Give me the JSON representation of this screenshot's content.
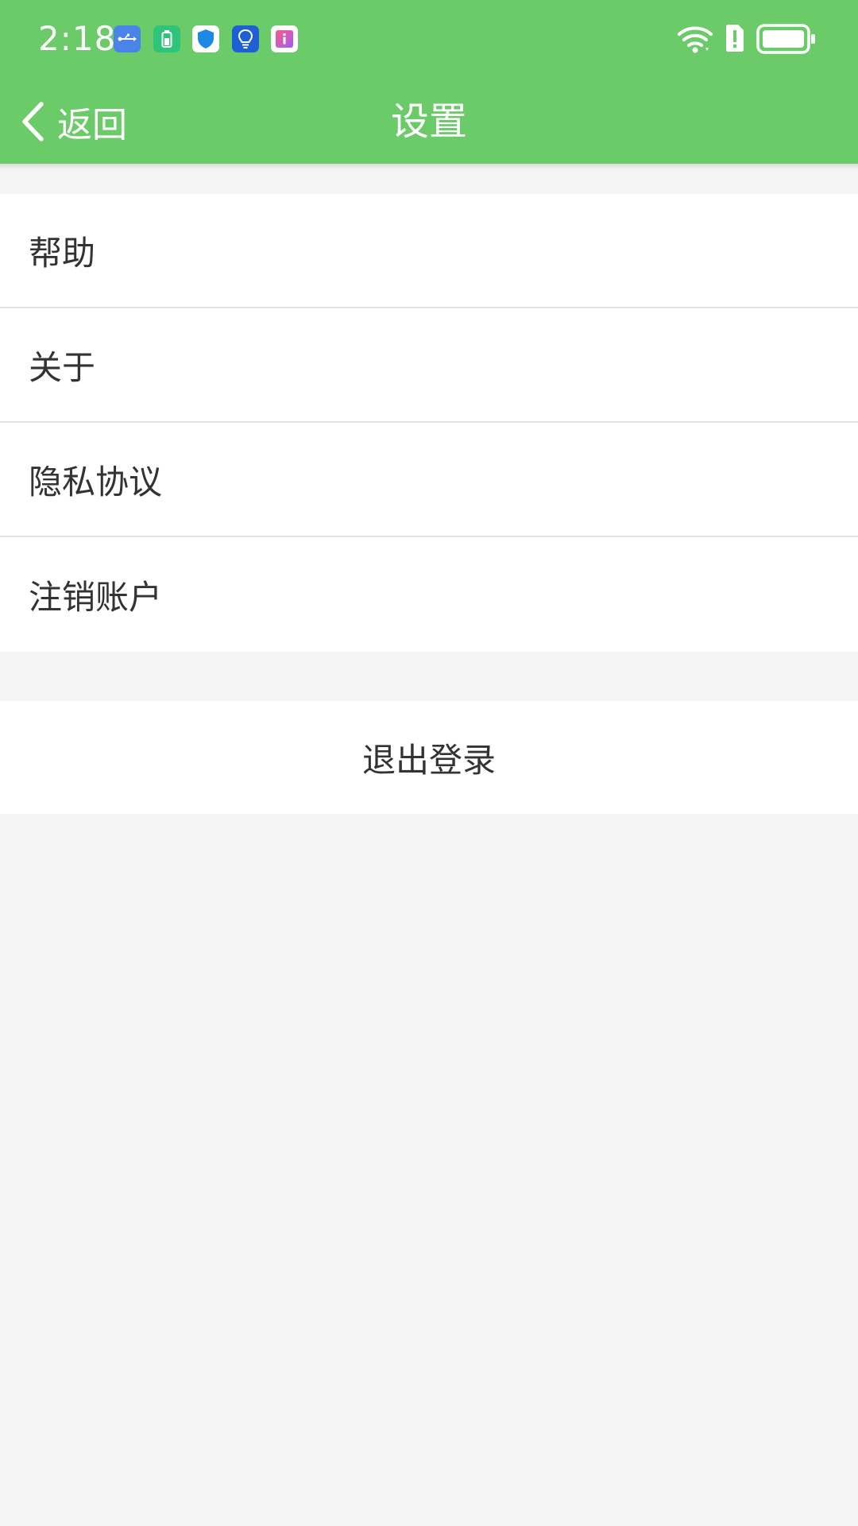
{
  "status_bar": {
    "time": "2:18",
    "notification_icons": [
      "usb-icon",
      "battery-saver-icon",
      "shield-icon",
      "lightbulb-icon",
      "info-app-icon"
    ],
    "right_icons": [
      "wifi-icon",
      "alert-sim-icon",
      "battery-icon"
    ]
  },
  "nav": {
    "back_label": "返回",
    "title": "设置"
  },
  "menu": {
    "items": [
      {
        "label": "帮助"
      },
      {
        "label": "关于"
      },
      {
        "label": "隐私协议"
      },
      {
        "label": "注销账户"
      }
    ]
  },
  "logout": {
    "label": "退出登录"
  },
  "colors": {
    "header_green": "#6ccb69",
    "page_background": "#f5f5f5",
    "text": "#333333"
  }
}
